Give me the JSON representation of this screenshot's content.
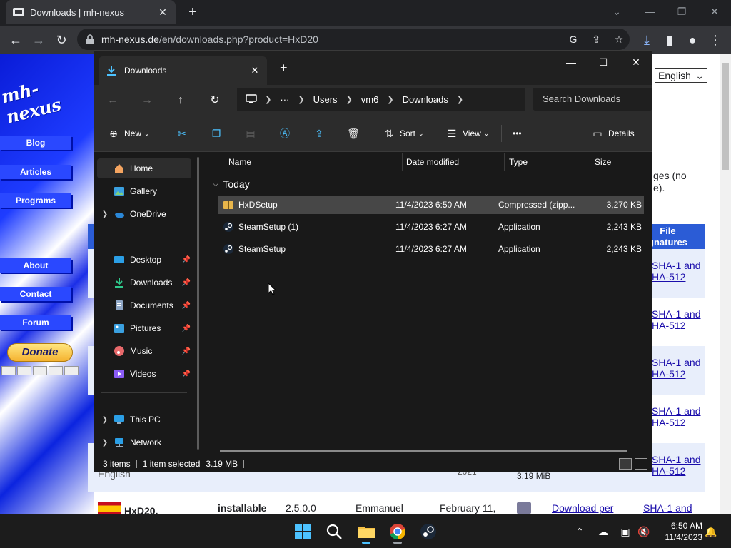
{
  "chrome": {
    "tab_title": "Downloads | mh-nexus",
    "url_host": "mh-nexus.de",
    "url_path": "/en/downloads.php?product=HxD20"
  },
  "website": {
    "logo": "mh-nexus",
    "nav": [
      "Blog",
      "Articles",
      "Programs",
      "About",
      "Contact",
      "Forum"
    ],
    "donate": "Donate",
    "language": "English",
    "partial_text_1": "ges (no",
    "partial_text_2": "e).",
    "sig_header_1": "File",
    "sig_header_2": "gnatures",
    "sig_link_1": "SHA-1 and",
    "sig_link_2": "HA-512",
    "row_lang": "English",
    "row_size": "3.19 MiB",
    "row_year": "2021",
    "bottom_name": "HxD20,",
    "bottom_type": "installable",
    "bottom_version": "2.5.0.0",
    "bottom_author": "Emmanuel",
    "bottom_date": "February 11,",
    "bottom_link": "Download per",
    "bottom_sig": "SHA-1 and"
  },
  "explorer": {
    "tab_title": "Downloads",
    "breadcrumb": [
      "Users",
      "vm6",
      "Downloads"
    ],
    "search_placeholder": "Search Downloads",
    "commands": {
      "new": "New",
      "sort": "Sort",
      "view": "View",
      "more": "•••",
      "details": "Details"
    },
    "nav": {
      "home": "Home",
      "gallery": "Gallery",
      "onedrive": "OneDrive",
      "desktop": "Desktop",
      "downloads": "Downloads",
      "documents": "Documents",
      "pictures": "Pictures",
      "music": "Music",
      "videos": "Videos",
      "this_pc": "This PC",
      "network": "Network"
    },
    "columns": {
      "name": "Name",
      "date": "Date modified",
      "type": "Type",
      "size": "Size"
    },
    "group": "Today",
    "files": [
      {
        "name": "HxDSetup",
        "date": "11/4/2023 6:50 AM",
        "type": "Compressed (zipp...",
        "size": "3,270 KB"
      },
      {
        "name": "SteamSetup (1)",
        "date": "11/4/2023 6:27 AM",
        "type": "Application",
        "size": "2,243 KB"
      },
      {
        "name": "SteamSetup",
        "date": "11/4/2023 6:27 AM",
        "type": "Application",
        "size": "2,243 KB"
      }
    ],
    "status": {
      "items": "3 items",
      "selected": "1 item selected",
      "size": "3.19 MB"
    }
  },
  "taskbar": {
    "time": "6:50 AM",
    "date": "11/4/2023"
  },
  "colors": {
    "accent": "#4cc2ff",
    "explorer_bg": "#191919",
    "selected_row": "#474747",
    "site_blue": "#2a48ff"
  }
}
